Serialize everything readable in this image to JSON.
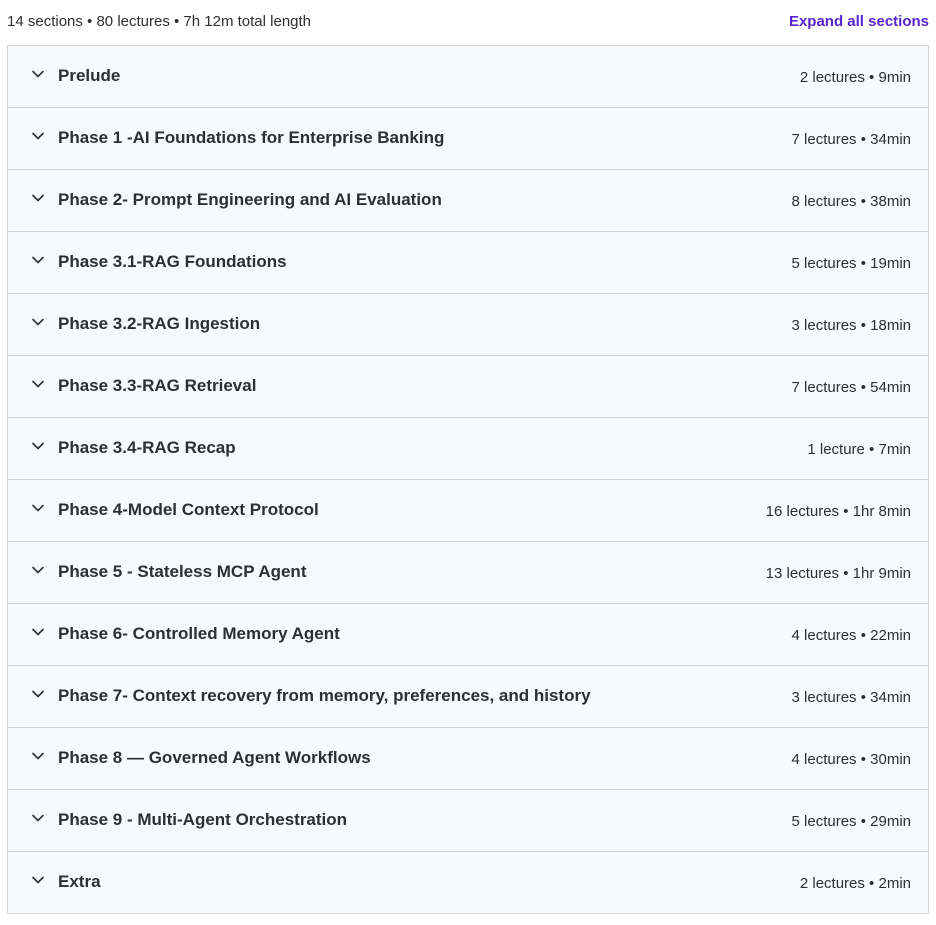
{
  "summary": {
    "text": "14 sections • 80 lectures • 7h 12m total length",
    "expand_label": "Expand all sections"
  },
  "sections": [
    {
      "title": "Prelude",
      "meta": "2 lectures • 9min"
    },
    {
      "title": "Phase 1 -AI Foundations for Enterprise Banking",
      "meta": "7 lectures • 34min"
    },
    {
      "title": "Phase 2- Prompt Engineering and AI Evaluation",
      "meta": "8 lectures • 38min"
    },
    {
      "title": "Phase 3.1-RAG Foundations",
      "meta": "5 lectures • 19min"
    },
    {
      "title": "Phase 3.2-RAG Ingestion",
      "meta": "3 lectures • 18min"
    },
    {
      "title": "Phase 3.3-RAG Retrieval",
      "meta": "7 lectures • 54min"
    },
    {
      "title": "Phase 3.4-RAG Recap",
      "meta": "1 lecture • 7min"
    },
    {
      "title": "Phase 4-Model Context Protocol",
      "meta": "16 lectures • 1hr 8min"
    },
    {
      "title": "Phase 5 - Stateless MCP Agent",
      "meta": "13 lectures • 1hr 9min"
    },
    {
      "title": "Phase 6- Controlled Memory Agent",
      "meta": "4 lectures • 22min"
    },
    {
      "title": "Phase 7- Context recovery from memory, preferences, and history",
      "meta": "3 lectures • 34min"
    },
    {
      "title": "Phase 8 — Governed Agent Workflows",
      "meta": "4 lectures • 30min"
    },
    {
      "title": "Phase 9 - Multi-Agent Orchestration",
      "meta": "5 lectures • 29min"
    },
    {
      "title": "Extra",
      "meta": "2 lectures • 2min"
    }
  ],
  "icons": {
    "section_toggle": "chevron-down-icon"
  },
  "colors": {
    "accent": "#5624d0",
    "text": "#2d2f31",
    "panel_bg": "#f7f9fa",
    "border": "#d1d7dc"
  }
}
